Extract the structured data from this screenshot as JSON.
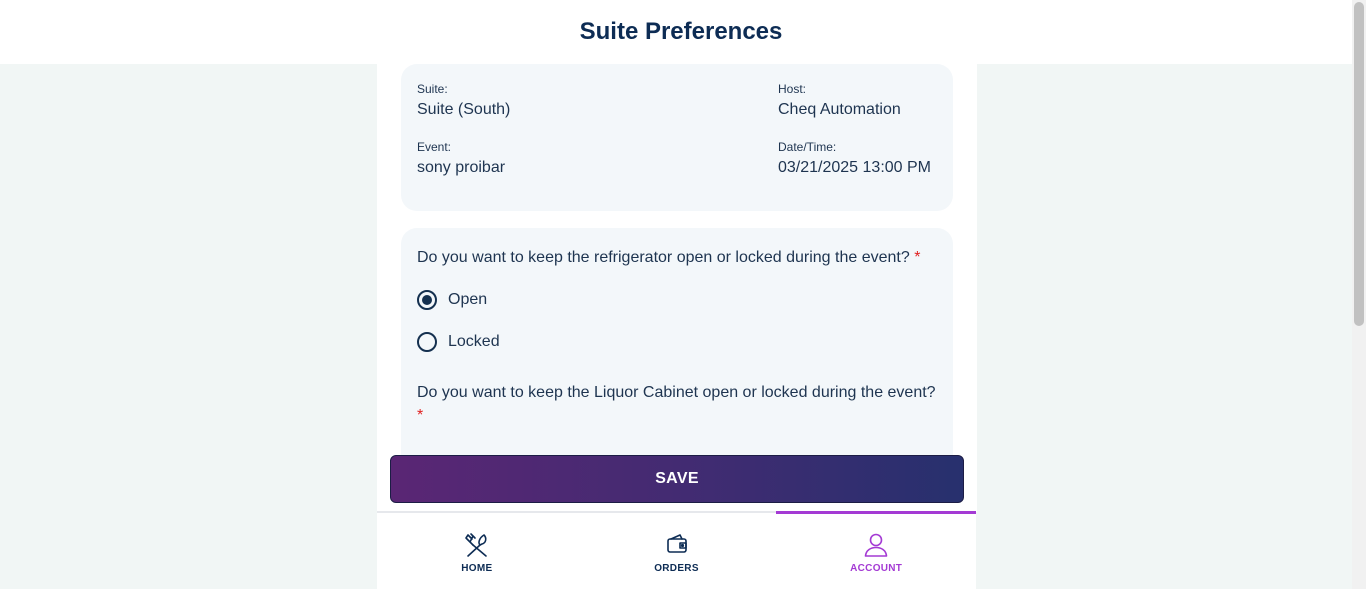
{
  "header": {
    "title": "Suite Preferences"
  },
  "info": {
    "suite_label": "Suite:",
    "suite_value": "Suite (South)",
    "host_label": "Host:",
    "host_value": "Cheq Automation",
    "event_label": "Event:",
    "event_value": "sony proibar",
    "datetime_label": "Date/Time:",
    "datetime_value": "03/21/2025 13:00 PM"
  },
  "questions": {
    "q1_text": "Do you want to keep the refrigerator open or locked during the event?",
    "q1_required": "*",
    "q1_options": [
      {
        "label": "Open",
        "selected": true
      },
      {
        "label": "Locked",
        "selected": false
      }
    ],
    "q2_text": "Do you want to keep the Liquor Cabinet open or locked during the event?",
    "q2_required": "*"
  },
  "save_button": {
    "label": "SAVE"
  },
  "nav": {
    "items": [
      {
        "label": "HOME",
        "icon": "utensils-icon",
        "active": false
      },
      {
        "label": "ORDERS",
        "icon": "wallet-icon",
        "active": false
      },
      {
        "label": "ACCOUNT",
        "icon": "user-icon",
        "active": true
      }
    ]
  },
  "colors": {
    "primary": "#0d2c54",
    "accent": "#a43ad4",
    "required": "#e02020"
  }
}
